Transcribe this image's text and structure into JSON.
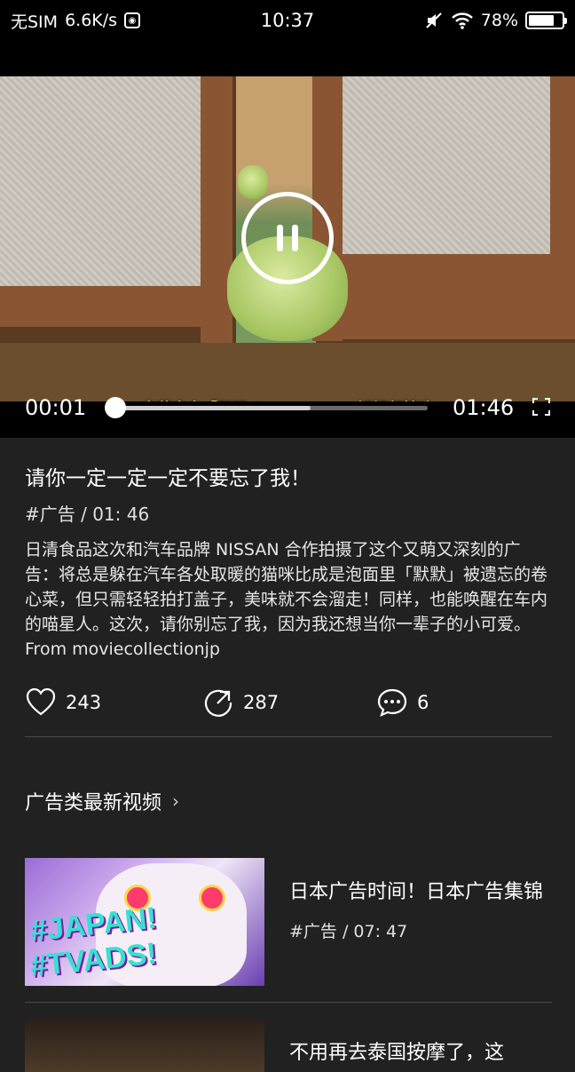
{
  "status_bar": {
    "carrier": "无SIM",
    "speed": "6.6K/s",
    "time": "10:37",
    "battery": "78%"
  },
  "player": {
    "subtitle_text": "❖ 字幕来自「开眼 Eyepetizer」短视频精选 ❖",
    "current_time": "00:01",
    "duration": "01:46",
    "progress_fraction": 0.01,
    "buffered_fraction": 0.63
  },
  "video": {
    "title": "请你一定一定一定不要忘了我！",
    "meta": "#广告 / 01: 46",
    "description": "日清食品这次和汽车品牌 NISSAN 合作拍摄了这个又萌又深刻的广告：将总是躲在汽车各处取暖的猫咪比成是泡面里「默默」被遗忘的卷心菜，但只需轻轻拍打盖子，美味就不会溜走！同样，也能唤醒在车内的喵星人。这次，请你别忘了我，因为我还想当你一辈子的小可爱。From moviecollectionjp",
    "likes": "243",
    "shares": "287",
    "comments": "6"
  },
  "section": {
    "title": "广告类最新视频"
  },
  "related": [
    {
      "title": "日本广告时间！日本广告集锦",
      "meta": "#广告 / 07: 47",
      "thumb_text_1": "#JAPAN!",
      "thumb_text_2": "#TVADS!"
    },
    {
      "title": "不用再去泰国按摩了，这"
    }
  ]
}
